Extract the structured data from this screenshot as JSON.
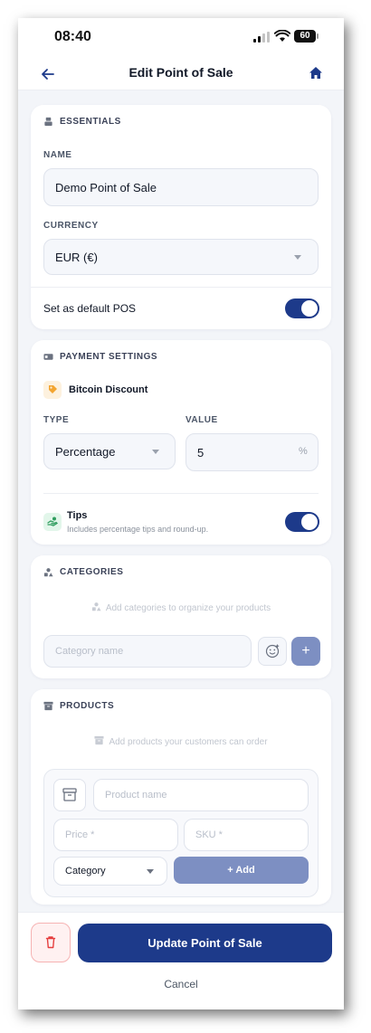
{
  "status": {
    "time": "08:40",
    "battery": "60"
  },
  "nav": {
    "title": "Edit Point of Sale"
  },
  "essentials": {
    "title": "ESSENTIALS",
    "name_label": "NAME",
    "name_value": "Demo Point of Sale",
    "currency_label": "CURRENCY",
    "currency_value": "EUR (€)",
    "default_label": "Set as default POS",
    "default_on": true
  },
  "payment": {
    "title": "PAYMENT SETTINGS",
    "discount_label": "Bitcoin Discount",
    "type_label": "TYPE",
    "type_value": "Percentage",
    "value_label": "VALUE",
    "value_value": "5",
    "value_unit": "%",
    "tips_label": "Tips",
    "tips_desc": "Includes percentage tips and round-up.",
    "tips_on": true
  },
  "categories": {
    "title": "CATEGORIES",
    "empty_hint": "Add categories to organize your products",
    "input_placeholder": "Category name",
    "add_symbol": "+"
  },
  "products": {
    "title": "PRODUCTS",
    "empty_hint": "Add products your customers can order",
    "name_placeholder": "Product name",
    "price_placeholder": "Price *",
    "sku_placeholder": "SKU *",
    "category_select": "Category",
    "add_label": "+ Add"
  },
  "footer": {
    "update_label": "Update Point of Sale",
    "cancel_label": "Cancel"
  },
  "colors": {
    "primary": "#1d3a8a",
    "primary_muted": "#7d8fc2",
    "danger": "#e53e3e",
    "background": "#f3f5f9"
  }
}
